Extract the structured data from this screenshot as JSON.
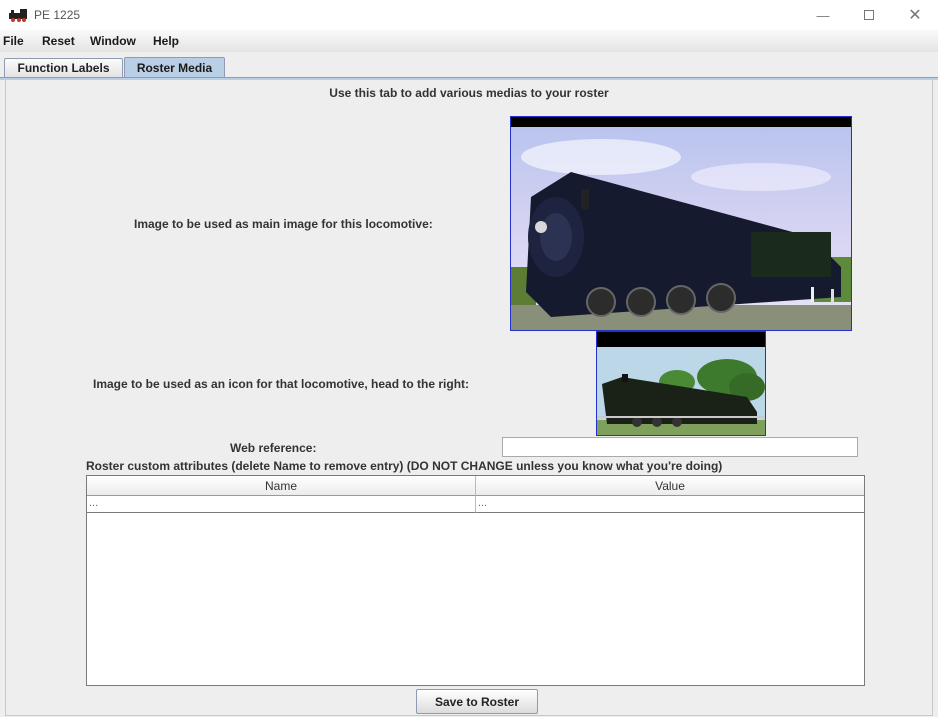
{
  "window": {
    "title": "PE 1225"
  },
  "menu": {
    "items": [
      "File",
      "Reset",
      "Window",
      "Help"
    ]
  },
  "tabs": {
    "function_labels": "Function Labels",
    "roster_media": "Roster Media"
  },
  "roster_media": {
    "heading": "Use this tab to add various medias to your roster",
    "main_image_label": "Image to be used as main image for this locomotive:",
    "icon_image_label": "Image to be used as an icon for that locomotive, head to the right:",
    "web_reference_label": "Web reference:",
    "web_reference_value": "",
    "attributes_label": "Roster custom attributes (delete Name to remove entry) (DO NOT CHANGE unless you know what you're doing)",
    "table": {
      "columns": [
        "Name",
        "Value"
      ],
      "rows": [
        [
          "...",
          "..."
        ]
      ]
    },
    "save_button": "Save to Roster"
  }
}
